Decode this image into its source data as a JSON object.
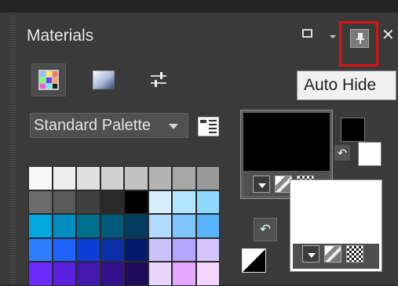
{
  "panel": {
    "title": "Materials"
  },
  "tooltip": {
    "text": "Auto Hide"
  },
  "palette_select": {
    "selected": "Standard Palette"
  },
  "tabs": [
    "swatches",
    "gradient",
    "mixer"
  ],
  "icons": {
    "restore": "restore-icon",
    "dropdown": "chevron-down-icon",
    "pin": "pin-icon",
    "close": "close-icon",
    "palette_options": "palette-options-icon",
    "swap": "swap-icon",
    "reset": "reset-colors-icon"
  },
  "highlight_color": "#e01010",
  "swatches": [
    "#f8f8f8",
    "#ededed",
    "#e0e0e0",
    "#d0d0d0",
    "#c2c2c2",
    "#b3b3b3",
    "#a7a7a7",
    "#9a9a9a",
    "#6c6c6c",
    "#5a5a5a",
    "#404040",
    "#2a2a2a",
    "#000000",
    "#d7eeff",
    "#b2e6ff",
    "#8fd8ff",
    "#00a6de",
    "#008fc0",
    "#006f8e",
    "#005a7a",
    "#003d5e",
    "#b2dcff",
    "#7fc4ff",
    "#59b3ff",
    "#2e7dff",
    "#1e62ff",
    "#0b3ed6",
    "#0b2fa6",
    "#031b6e",
    "#c9c2ff",
    "#b4a6ff",
    "#d6c6ff",
    "#6a2bff",
    "#5a1fe0",
    "#4318b0",
    "#33108a",
    "#200a5a",
    "#e8d6ff",
    "#e3a8ff",
    "#f4d5ff"
  ],
  "foreground_color": "#000000",
  "background_color": "#ffffff"
}
